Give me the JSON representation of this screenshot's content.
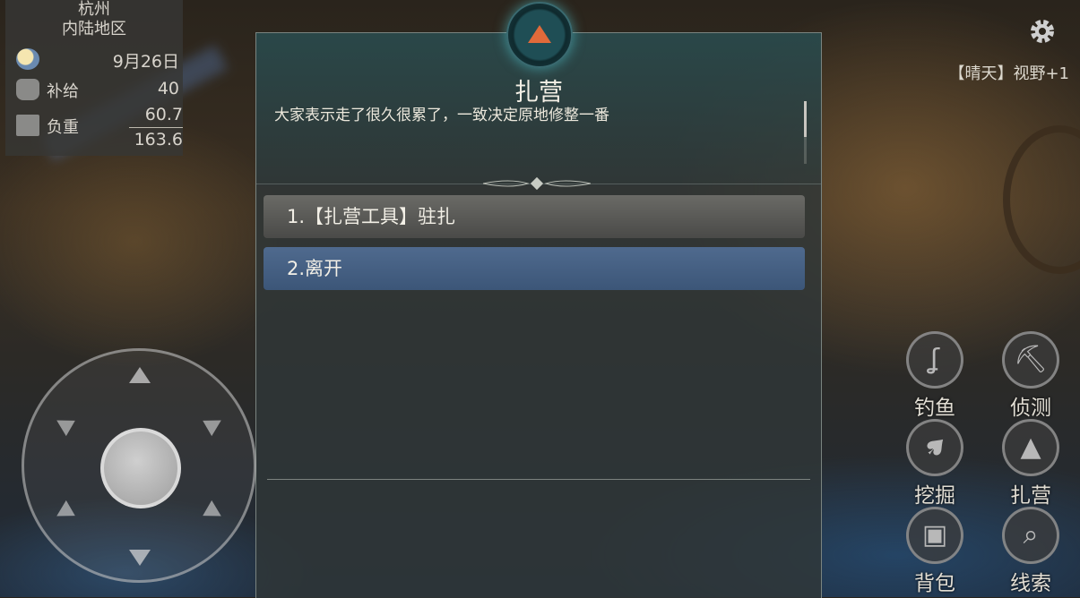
{
  "location": {
    "city": "杭州",
    "region": "内陆地区"
  },
  "stats": {
    "date": "9月26日",
    "supply_label": "补给",
    "supply_value": "40",
    "load_label": "负重",
    "load_current": "60.7",
    "load_max": "163.6"
  },
  "dialog": {
    "title": "扎营",
    "description": "大家表示走了很久很累了，一致决定原地修整一番",
    "options": [
      "1.【扎营工具】驻扎",
      "2.离开"
    ]
  },
  "status": {
    "weather": "【晴天】视野+1"
  },
  "actions": [
    {
      "label": "钓鱼",
      "icon": "fishing-hook-icon"
    },
    {
      "label": "侦测",
      "icon": "pickaxe-icon"
    },
    {
      "label": "挖掘",
      "icon": "shovel-icon"
    },
    {
      "label": "扎营",
      "icon": "tent-icon"
    },
    {
      "label": "背包",
      "icon": "backpack-icon"
    },
    {
      "label": "线索",
      "icon": "magnifier-icon"
    }
  ],
  "colors": {
    "accent": "#e06a3a",
    "option_selected": "#4f6a8e",
    "badge_glow": "#50c8d2"
  }
}
